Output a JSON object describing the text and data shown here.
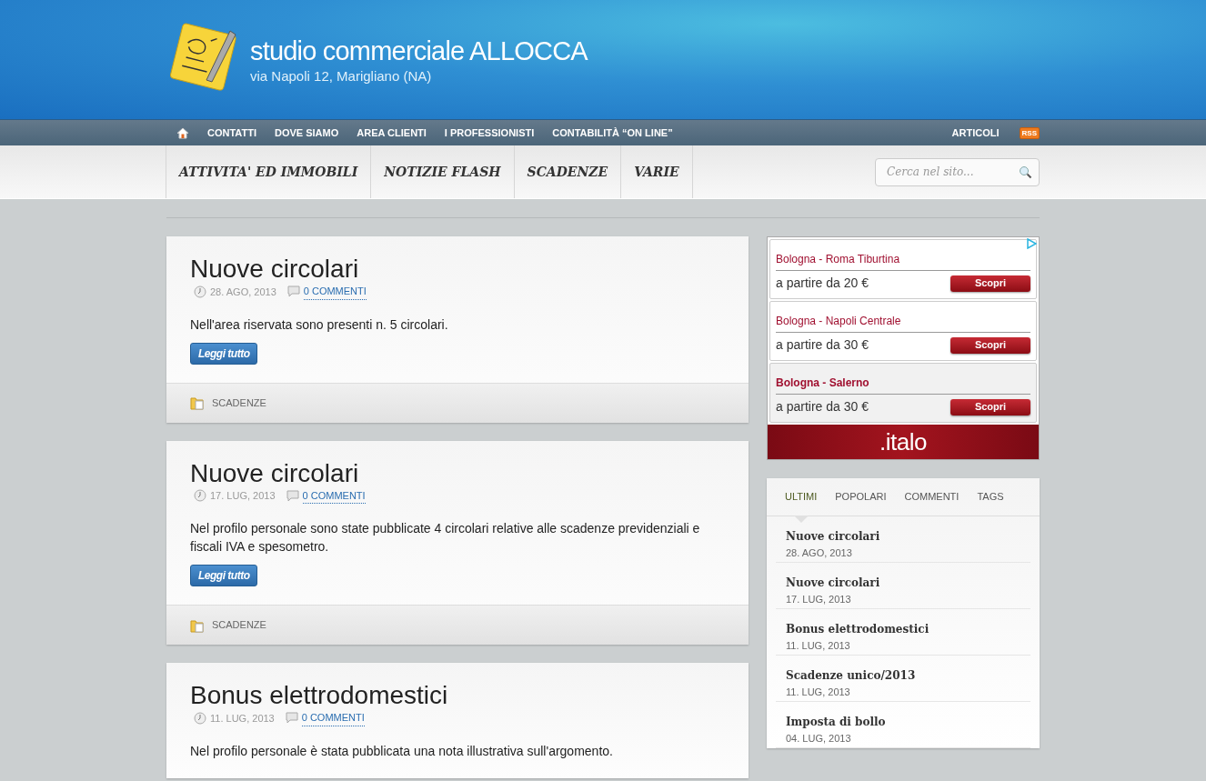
{
  "header": {
    "title": "studio commerciale ALLOCCA",
    "subtitle": "via Napoli 12, Marigliano (NA)"
  },
  "top_nav": {
    "items": [
      "CONTATTI",
      "DOVE SIAMO",
      "AREA CLIENTI",
      "I PROFESSIONISTI",
      "CONTABILITÀ “ON LINE”"
    ],
    "right_link": "ARTICOLI",
    "rss": "RSS"
  },
  "category_nav": {
    "items": [
      "ATTIVITA' ED IMMOBILI",
      "NOTIZIE FLASH",
      "SCADENZE",
      "VARIE"
    ],
    "search": {
      "placeholder": "Cerca nel sito..."
    }
  },
  "posts": [
    {
      "title": "Nuove circolari",
      "date": "28. AGO, 2013",
      "comments": "0 COMMENTI",
      "excerpt": "Nell'area riservata sono presenti n. 5 circolari.",
      "button": "Leggi tutto",
      "category": "SCADENZE"
    },
    {
      "title": "Nuove circolari",
      "date": "17. LUG, 2013",
      "comments": "0 COMMENTI",
      "excerpt": "Nel profilo personale sono state pubblicate 4 circolari  relative alle scadenze previdenziali e fiscali IVA e  spesometro.",
      "button": "Leggi tutto",
      "category": "SCADENZE"
    },
    {
      "title": "Bonus elettrodomestici",
      "date": "11. LUG, 2013",
      "comments": "0 COMMENTI",
      "excerpt": "Nel profilo personale è stata pubblicata una nota illustrativa sull'argomento."
    }
  ],
  "ad": {
    "offers": [
      {
        "route": "Bologna - Roma Tiburtina",
        "price": "a partire da 20 €",
        "button": "Scopri",
        "highlighted": false
      },
      {
        "route": "Bologna - Napoli Centrale",
        "price": "a partire da 30 €",
        "button": "Scopri",
        "highlighted": false
      },
      {
        "route": "Bologna - Salerno",
        "price": "a partire da 30 €",
        "button": "Scopri",
        "highlighted": true
      }
    ],
    "brand": ".italo"
  },
  "sidebar_tabs": {
    "tabs": [
      {
        "label": "ULTIMI",
        "selected": true
      },
      {
        "label": "POPOLARI",
        "selected": false
      },
      {
        "label": "COMMENTI",
        "selected": false
      },
      {
        "label": "TAGS",
        "selected": false
      }
    ],
    "items": [
      {
        "title": "Nuove circolari",
        "date": "28. AGO, 2013"
      },
      {
        "title": "Nuove circolari",
        "date": "17. LUG, 2013"
      },
      {
        "title": "Bonus elettrodomestici",
        "date": "11. LUG, 2013"
      },
      {
        "title": "Scadenze unico/2013",
        "date": "11. LUG, 2013"
      },
      {
        "title": "Imposta di bollo",
        "date": "04. LUG, 2013"
      }
    ]
  }
}
